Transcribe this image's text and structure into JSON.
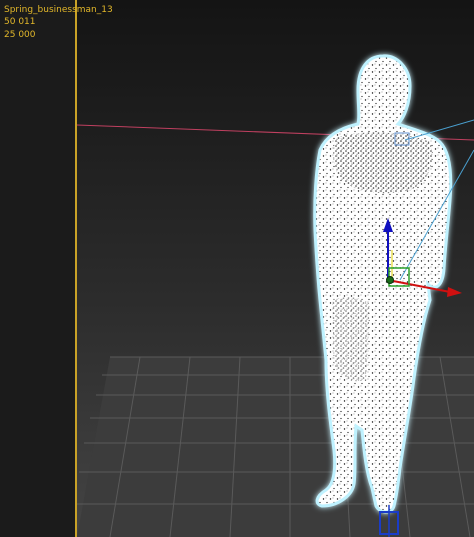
{
  "viewport_info": {
    "object_name": "Spring_businessman_13",
    "value_1": "50 011",
    "value_2": "25 000"
  },
  "colors": {
    "info_text": "#e2b72a",
    "frame_line": "#c9a227",
    "horizon_line": "#c04060",
    "gizmo_y_axis": "#1010c0",
    "gizmo_x_axis": "#d01010",
    "gizmo_z_axis": "#2aa02a",
    "figure_glow": "#9fe8ff"
  },
  "icons": {
    "move_gizmo": "transform-gizmo-icon",
    "pivot": "pivot-icon"
  }
}
